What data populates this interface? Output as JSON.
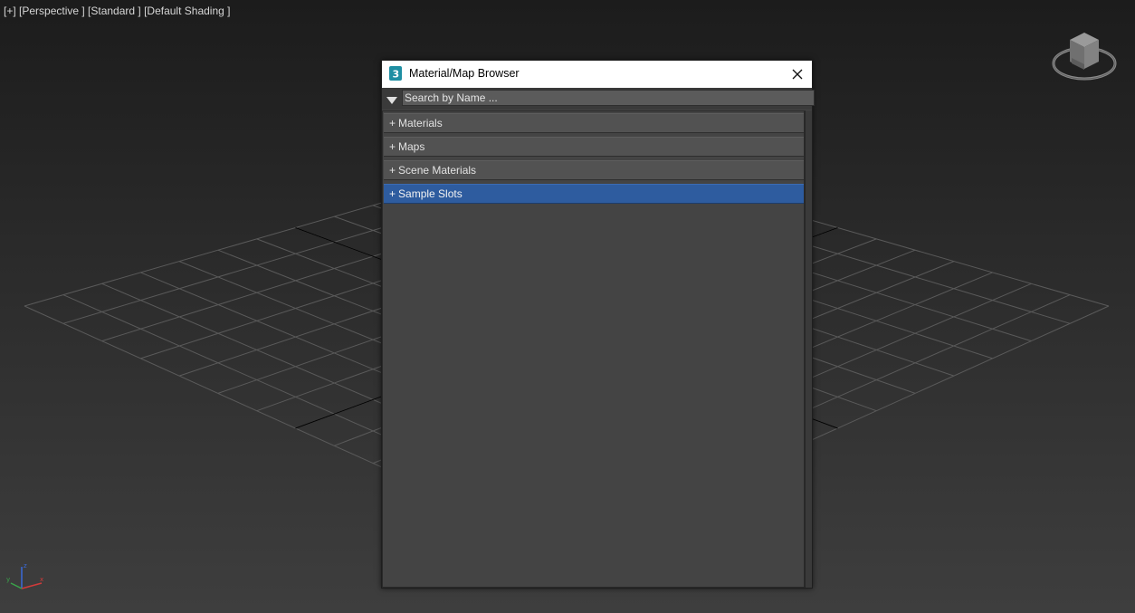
{
  "viewport": {
    "label": "[+] [Perspective ] [Standard ] [Default Shading ]",
    "background_colors": [
      "#1c1c1c",
      "#3e3e3e"
    ],
    "grid_color": "#5a5a5a",
    "axis_icons": [
      "viewcube-icon",
      "axis-tripod-icon"
    ]
  },
  "dialog": {
    "title": "Material/Map Browser",
    "app_icon": "3ds-max-icon",
    "close_icon": "close-icon",
    "search": {
      "placeholder": "Search by Name ...",
      "value": "",
      "filter_icon": "triangle-down-icon"
    },
    "groups": [
      {
        "prefix": "+",
        "label": "Materials",
        "selected": false
      },
      {
        "prefix": "+",
        "label": "Maps",
        "selected": false
      },
      {
        "prefix": "+",
        "label": "Scene Materials",
        "selected": false
      },
      {
        "prefix": "+",
        "label": "Sample Slots",
        "selected": true
      }
    ],
    "colors": {
      "selection": "#2e5c9f",
      "panel": "#444444",
      "group_row": "#525252"
    }
  }
}
